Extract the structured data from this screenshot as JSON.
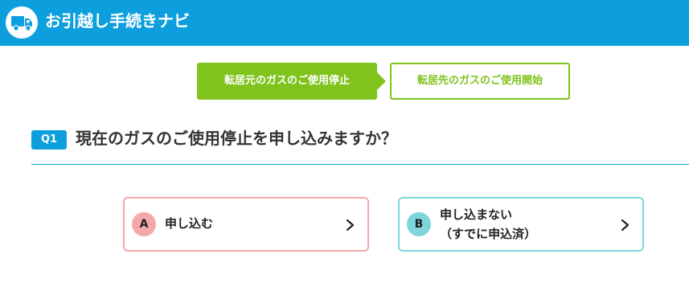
{
  "header": {
    "title": "お引越し手続きナビ",
    "icon": "truck-icon",
    "color": "#0d9fdd"
  },
  "steps": [
    {
      "label": "転居元のガスのご使用停止",
      "state": "active"
    },
    {
      "label": "転居先のガスのご使用開始",
      "state": "inactive"
    }
  ],
  "question": {
    "badge": "Q1",
    "text": "現在のガスのご使用停止を申し込みますか？"
  },
  "options": [
    {
      "letter": "A",
      "label": "申し込む",
      "accent": "#f4a9a8",
      "icon": "chevron-right-icon"
    },
    {
      "letter": "B",
      "label": "申し込まない",
      "sublabel": "（すでに申込済）",
      "accent": "#7fd5dc",
      "icon": "chevron-right-icon"
    }
  ],
  "colors": {
    "accent_green": "#7fc31c",
    "accent_blue": "#0d9fdd"
  }
}
